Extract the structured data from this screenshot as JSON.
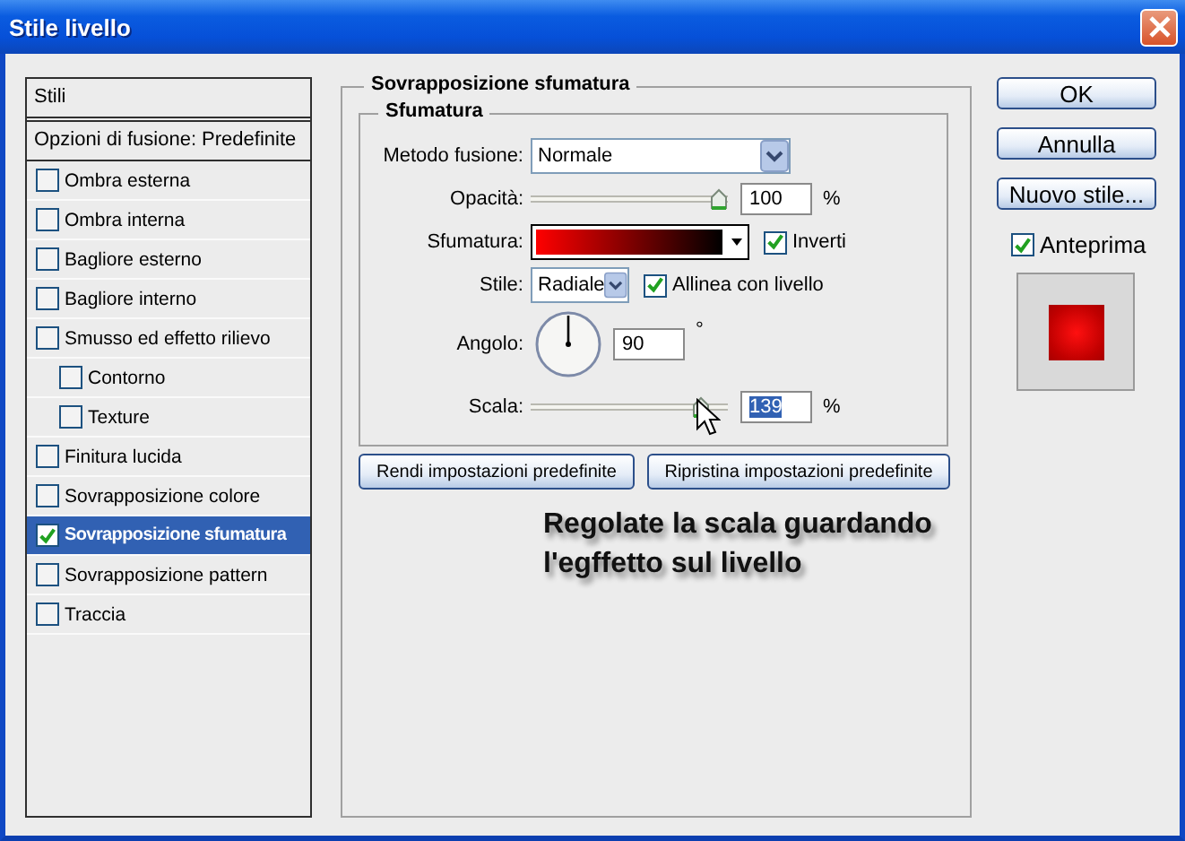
{
  "window": {
    "title": "Stile livello"
  },
  "sidebar": {
    "header": "Stili",
    "blend_options": "Opzioni di fusione: Predefinite",
    "items": [
      {
        "label": "Ombra esterna",
        "checked": false,
        "selected": false
      },
      {
        "label": "Ombra interna",
        "checked": false,
        "selected": false
      },
      {
        "label": "Bagliore esterno",
        "checked": false,
        "selected": false
      },
      {
        "label": "Bagliore interno",
        "checked": false,
        "selected": false
      },
      {
        "label": "Smusso ed effetto rilievo",
        "checked": false,
        "selected": false,
        "children": [
          {
            "label": "Contorno",
            "checked": false,
            "selected": false
          },
          {
            "label": "Texture",
            "checked": false,
            "selected": false
          }
        ]
      },
      {
        "label": "Finitura lucida",
        "checked": false,
        "selected": false
      },
      {
        "label": "Sovrapposizione colore",
        "checked": false,
        "selected": false
      },
      {
        "label": "Sovrapposizione sfumatura",
        "checked": true,
        "selected": true
      },
      {
        "label": "Sovrapposizione pattern",
        "checked": false,
        "selected": false
      },
      {
        "label": "Traccia",
        "checked": false,
        "selected": false
      }
    ]
  },
  "panel": {
    "title": "Sovrapposizione sfumatura",
    "group": {
      "title": "Sfumatura",
      "blend_mode": {
        "label": "Metodo fusione:",
        "value": "Normale"
      },
      "opacity": {
        "label": "Opacità:",
        "level": 1,
        "value": "100",
        "unit": "%"
      },
      "gradient": {
        "label": "Sfumatura:",
        "reverse": {
          "label": "Inverti",
          "checked": true
        }
      },
      "style": {
        "label": "Stile:",
        "value": "Radiale",
        "align": {
          "label": "Allinea con livello",
          "checked": true
        }
      },
      "angle": {
        "label": "Angolo:",
        "value": "90",
        "unit": "°"
      },
      "scale": {
        "label": "Scala:",
        "level": 0.9,
        "value": "139",
        "unit": "%",
        "highlighted": true
      }
    },
    "buttons": [
      "Rendi impostazioni predefinite",
      "Ripristina impostazioni predefinite"
    ]
  },
  "actions": {
    "buttons": [
      "OK",
      "Annulla",
      "Nuovo stile..."
    ],
    "preview": {
      "label": "Anteprima",
      "checked": true
    }
  },
  "annotation": "Regolate la scala guardando l'egffetto sul livello"
}
